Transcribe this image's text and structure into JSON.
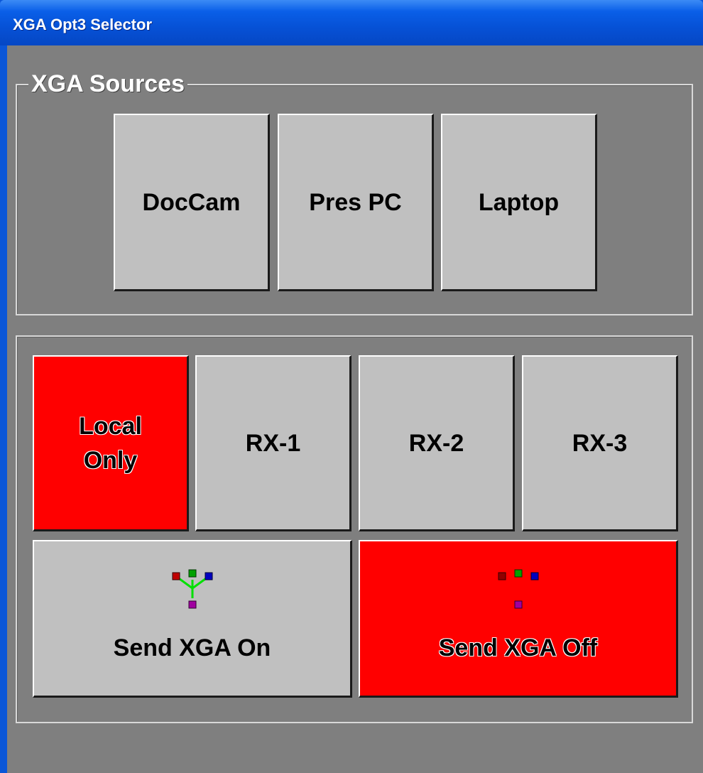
{
  "window": {
    "title": "XGA Opt3 Selector"
  },
  "sources_group": {
    "legend": "XGA Sources",
    "buttons": [
      {
        "label": "DocCam",
        "active": false
      },
      {
        "label": "Pres PC",
        "active": false
      },
      {
        "label": "Laptop",
        "active": false
      }
    ]
  },
  "outputs_group": {
    "buttons": [
      {
        "label": "Local\nOnly",
        "active": true
      },
      {
        "label": "RX-1",
        "active": false
      },
      {
        "label": "RX-2",
        "active": false
      },
      {
        "label": "RX-3",
        "active": false
      }
    ],
    "send_on": {
      "label": "Send XGA On",
      "icon": "network-connected-icon",
      "active": false
    },
    "send_off": {
      "label": "Send XGA Off",
      "icon": "network-disconnected-icon",
      "active": true
    }
  },
  "colors": {
    "active": "#ff0000",
    "inactive": "#c0c0c0",
    "background": "#7f7f7f",
    "titlebar": "#0651d6"
  }
}
